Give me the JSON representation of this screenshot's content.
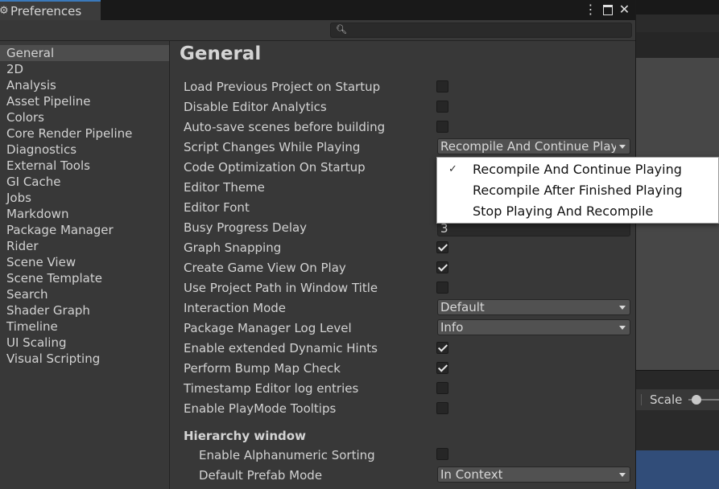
{
  "window": {
    "title": "Preferences",
    "accent_color": "#3a79bb",
    "title_icons": [
      "more-icon",
      "maximize-icon",
      "close-icon"
    ],
    "search": {
      "placeholder": "",
      "value": ""
    }
  },
  "sidebar": {
    "selected": "General",
    "items": [
      {
        "label": "General"
      },
      {
        "label": "2D"
      },
      {
        "label": "Analysis"
      },
      {
        "label": "Asset Pipeline"
      },
      {
        "label": "Colors"
      },
      {
        "label": "Core Render Pipeline"
      },
      {
        "label": "Diagnostics"
      },
      {
        "label": "External Tools"
      },
      {
        "label": "GI Cache"
      },
      {
        "label": "Jobs"
      },
      {
        "label": "Markdown"
      },
      {
        "label": "Package Manager"
      },
      {
        "label": "Rider"
      },
      {
        "label": "Scene View"
      },
      {
        "label": "Scene Template"
      },
      {
        "label": "Search"
      },
      {
        "label": "Shader Graph"
      },
      {
        "label": "Timeline"
      },
      {
        "label": "UI Scaling"
      },
      {
        "label": "Visual Scripting"
      }
    ]
  },
  "main": {
    "title": "General",
    "rows": [
      {
        "label": "Load Previous Project on Startup",
        "type": "checkbox",
        "checked": false
      },
      {
        "label": "Disable Editor Analytics",
        "type": "checkbox",
        "checked": false
      },
      {
        "label": "Auto-save scenes before building",
        "type": "checkbox",
        "checked": false
      },
      {
        "label": "Script Changes While Playing",
        "type": "dropdown",
        "value": "Recompile And Continue Playi"
      },
      {
        "label": "Code Optimization On Startup",
        "type": "hidden"
      },
      {
        "label": "Editor Theme",
        "type": "hidden"
      },
      {
        "label": "Editor Font",
        "type": "hidden"
      },
      {
        "label": "Busy Progress Delay",
        "type": "text",
        "value": "3"
      },
      {
        "label": "Graph Snapping",
        "type": "checkbox",
        "checked": true
      },
      {
        "label": "Create Game View On Play",
        "type": "checkbox",
        "checked": true
      },
      {
        "label": "Use Project Path in Window Title",
        "type": "checkbox",
        "checked": false
      },
      {
        "label": "Interaction Mode",
        "type": "dropdown",
        "value": "Default"
      },
      {
        "label": "Package Manager Log Level",
        "type": "dropdown",
        "value": "Info"
      },
      {
        "label": "Enable extended Dynamic Hints",
        "type": "checkbox",
        "checked": true
      },
      {
        "label": "Perform Bump Map Check",
        "type": "checkbox",
        "checked": true
      },
      {
        "label": "Timestamp Editor log entries",
        "type": "checkbox",
        "checked": false
      },
      {
        "label": "Enable PlayMode Tooltips",
        "type": "checkbox",
        "checked": false
      }
    ],
    "hierarchy": {
      "header": "Hierarchy window",
      "rows": [
        {
          "label": "Enable Alphanumeric Sorting",
          "type": "checkbox",
          "checked": false
        },
        {
          "label": "Default Prefab Mode",
          "type": "dropdown",
          "value": "In Context"
        }
      ]
    }
  },
  "popup": {
    "selected_index": 0,
    "options": [
      "Recompile And Continue Playing",
      "Recompile After Finished Playing",
      "Stop Playing And Recompile"
    ]
  },
  "background": {
    "scale_label": "Scale"
  }
}
